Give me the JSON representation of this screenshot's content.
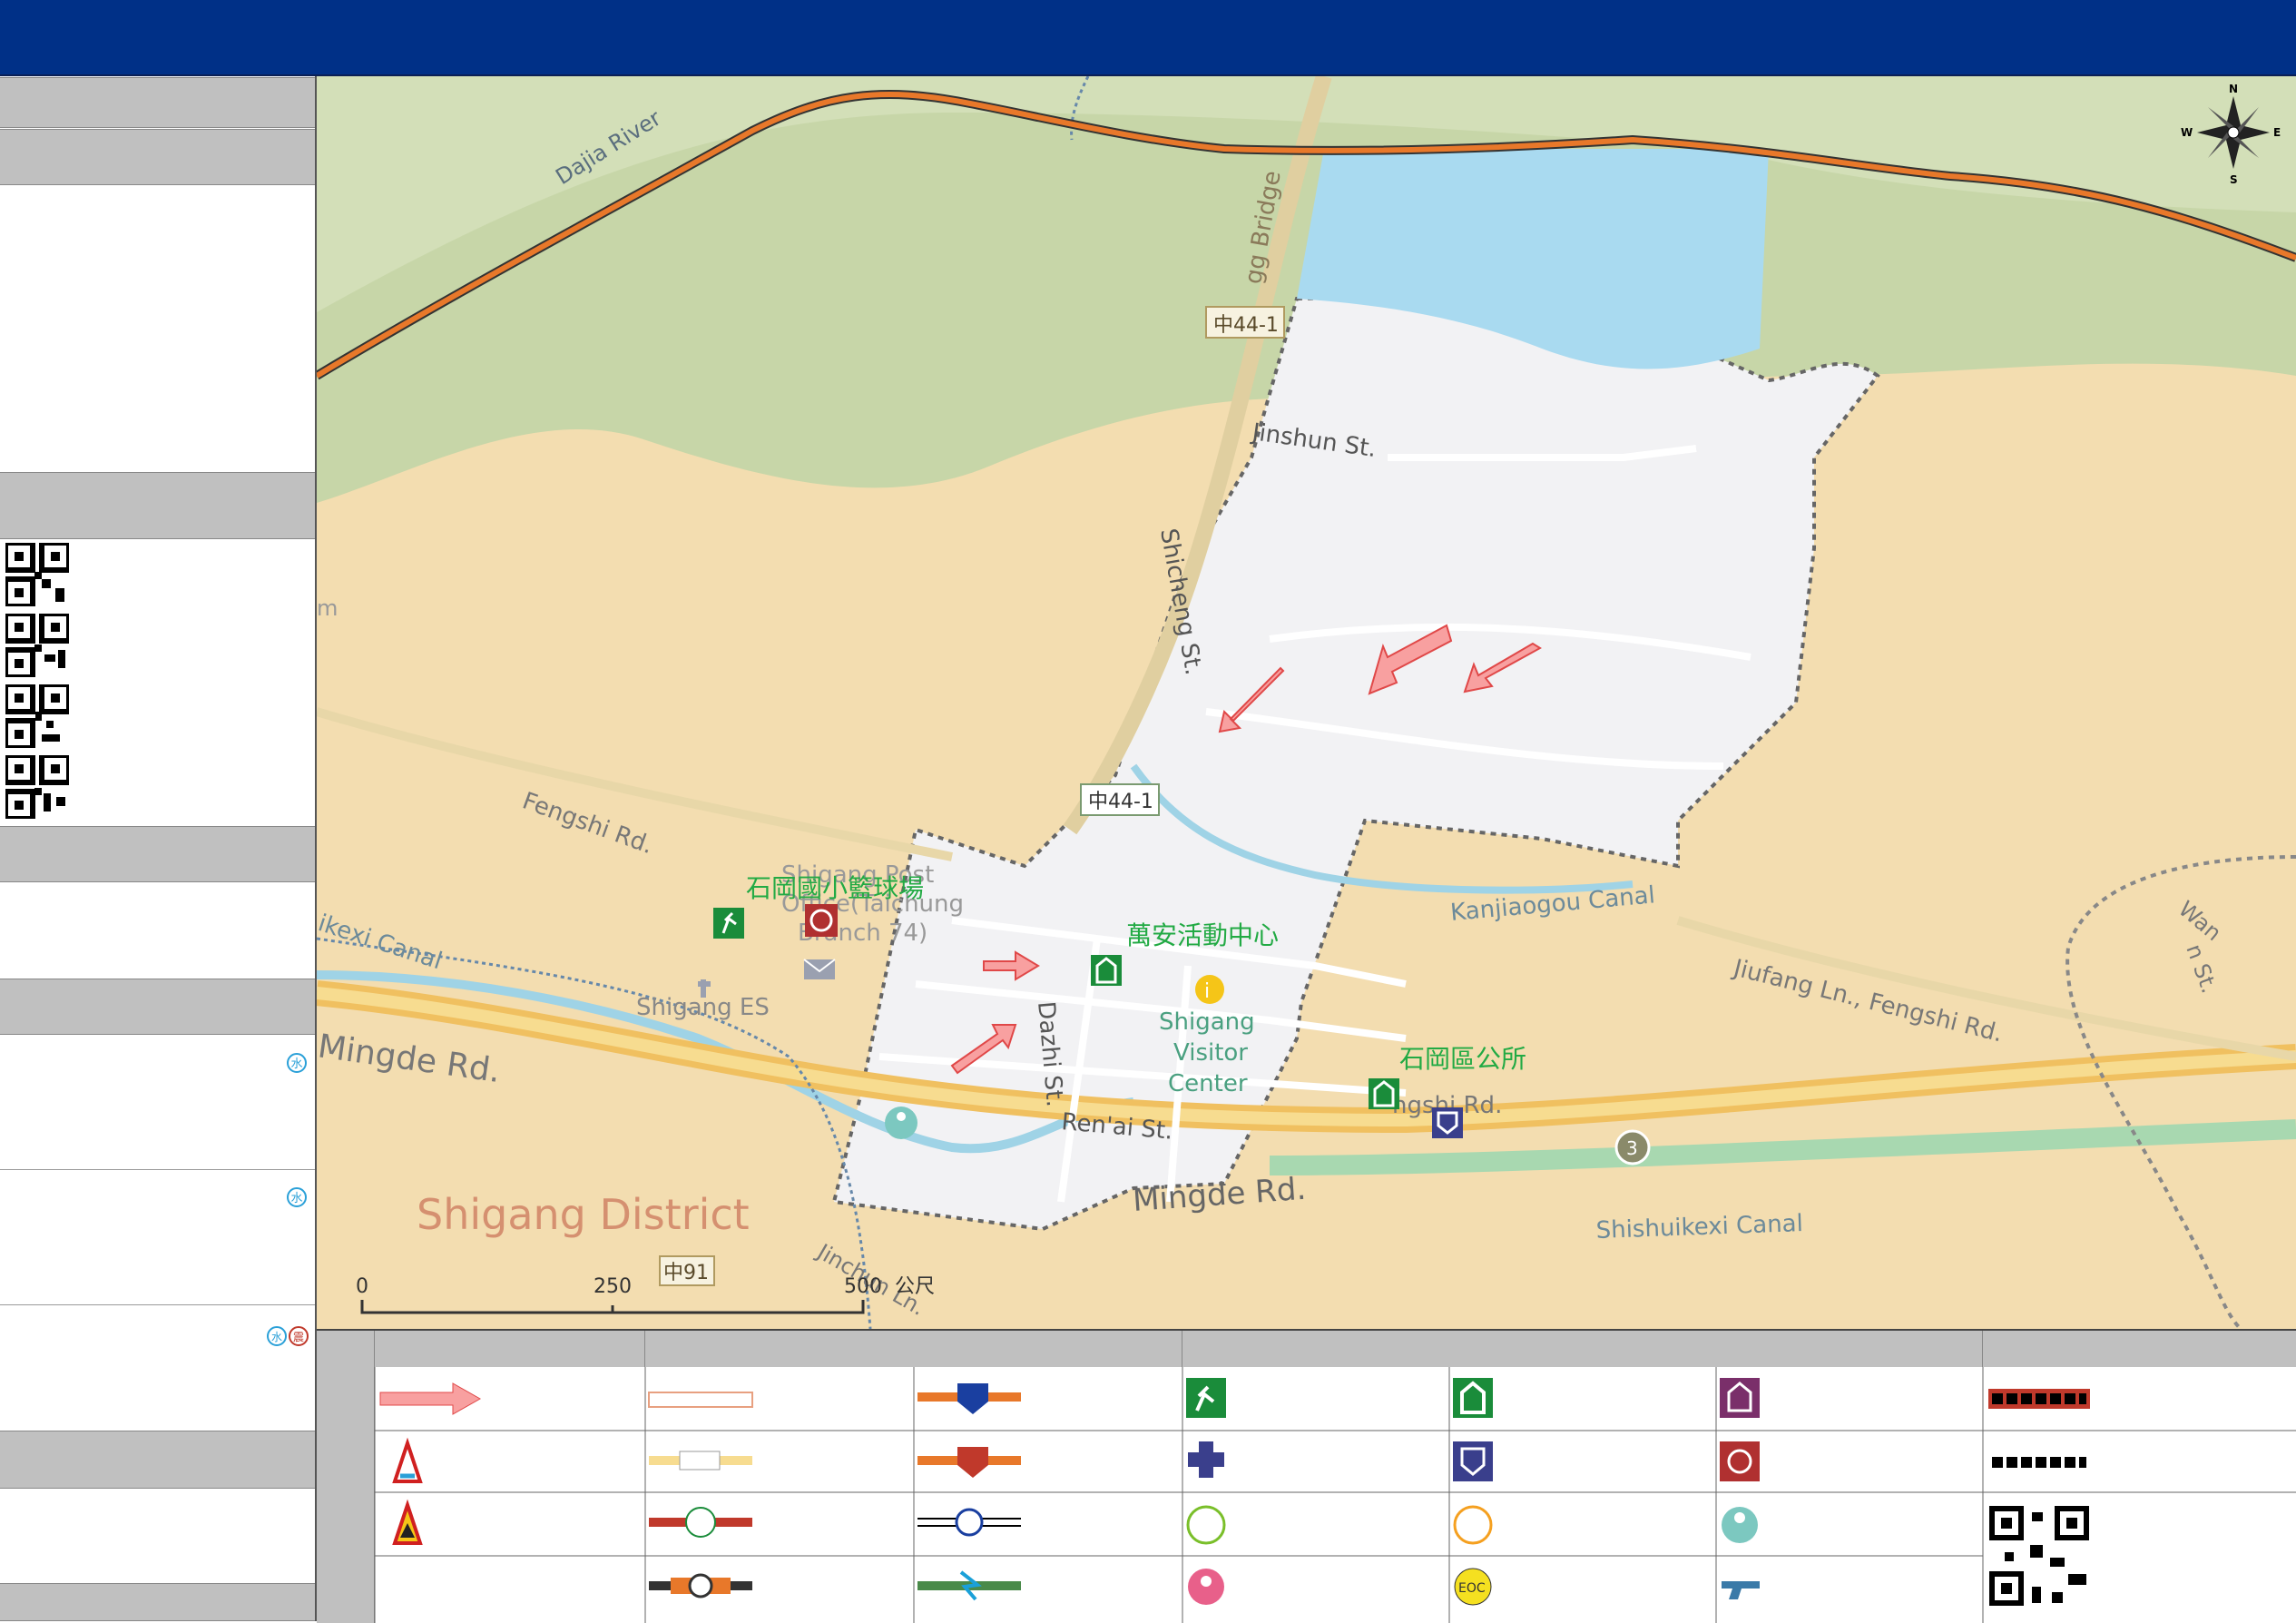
{
  "map": {
    "labels": {
      "dajia_river": "Dajia River",
      "bridge": "gg Bridge",
      "jinshun": "Jinshun St.",
      "shicheng": "Shicheng St.",
      "route_1": "中44-1",
      "route_2": "中44-1",
      "fengshi": "Fengshi Rd.",
      "kanjiaogou": "Kanjiaogou Canal",
      "jiufang": "Jiufang Ln., Fengshi Rd.",
      "wan": "Wan",
      "wan_st": "n St.",
      "mingde_left": "Mingde Rd.",
      "mingde_center": "Mingde Rd.",
      "district": "Shigang District",
      "shishuikexi": "Shishuikexi Canal",
      "canal_left": "ikexi Canal",
      "shigang_es": "Shigang ES",
      "shigang_post": "Shigang Post",
      "post_office": "Office(Taichung",
      "post_branch": "Branch 74)",
      "dazhi": "Dazhi St.",
      "renai": "Ren'ai St.",
      "visitor_1": "Shigang",
      "visitor_2": "Visitor",
      "visitor_3": "Center",
      "basketball": "石岡國小籃球場",
      "wanan": "萬安活動中心",
      "district_office": "石岡區公所",
      "road_partial": "ngshi Rd.",
      "highway": "3",
      "route_91": "中91",
      "jinchun": "Jinchun Ln.",
      "edge_m": "m"
    },
    "scale": {
      "t0": "0",
      "t1": "250",
      "t2": "500",
      "unit": "公尺"
    },
    "compass": {
      "n": "N",
      "s": "S",
      "e": "E",
      "w": "W"
    }
  },
  "sidebar": {
    "water_icon_1": "水",
    "water_icon_2": "水",
    "water_icon_3": "水",
    "fire_icon": "震"
  },
  "legend": {
    "eoc_label": "EOC"
  },
  "colors": {
    "header": "#003087",
    "sidebar_bar": "#c0c0c0",
    "map_land": "#f3ddb0",
    "map_forest": "#c7d6a8",
    "map_water": "#a9daf0",
    "village": "#f2f2f4",
    "boundary": "#e8782a",
    "arrow": "#f08080",
    "shelter_green": "#1a8c3a"
  }
}
